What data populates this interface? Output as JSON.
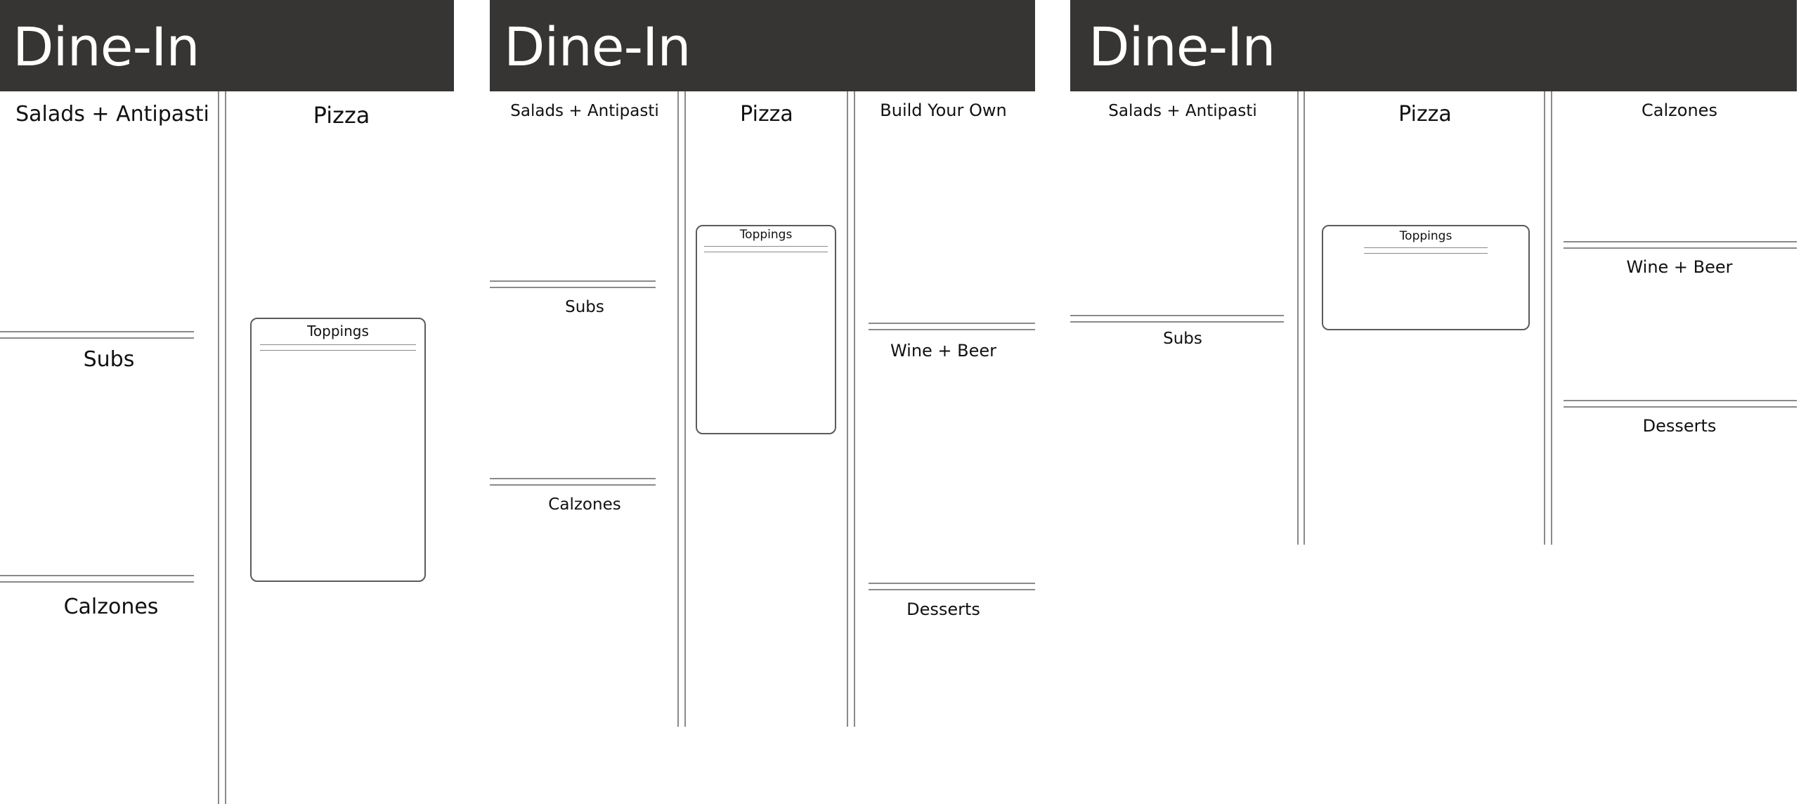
{
  "layouts": [
    {
      "header_title": "Dine-In",
      "sections": {
        "s1": "Salads + Antipasti",
        "s2": "Subs",
        "s3": "Calzones",
        "s4": "Pizza"
      },
      "toppings": "Toppings"
    },
    {
      "header_title": "Dine-In",
      "sections": {
        "s1": "Salads + Antipasti",
        "s2": "Subs",
        "s3": "Calzones",
        "s4": "Pizza",
        "s5": "Build Your Own",
        "s6": "Wine + Beer",
        "s7": "Desserts"
      },
      "toppings": "Toppings"
    },
    {
      "header_title": "Dine-In",
      "sections": {
        "s1": "Salads + Antipasti",
        "s2": "Subs",
        "s3": "Pizza",
        "s4": "Calzones",
        "s5": "Wine + Beer",
        "s6": "Desserts"
      },
      "toppings": "Toppings"
    }
  ],
  "colors": {
    "header_bg": "#363533",
    "header_text": "#ffffff",
    "rule": "#8a8a8a",
    "box_border": "#5b5b5b"
  }
}
